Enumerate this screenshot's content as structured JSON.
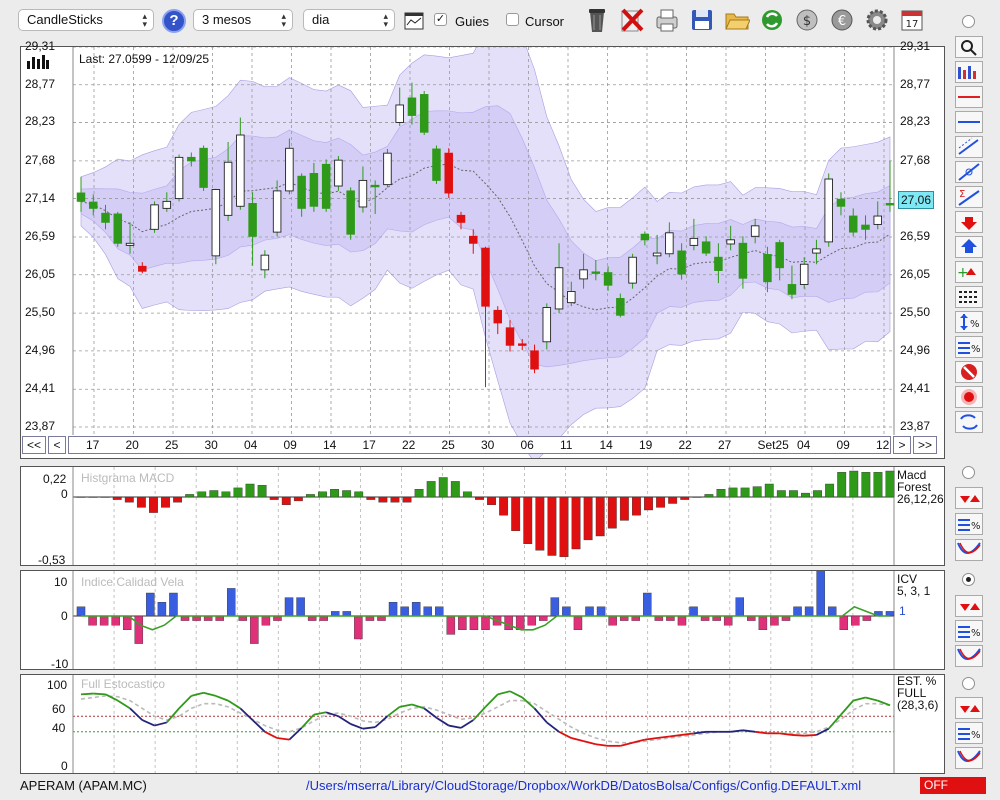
{
  "toolbar": {
    "chart_type": "CandleSticks",
    "period": "3 mesos",
    "interval": "dia",
    "guides_label": "Guies",
    "guides_checked": true,
    "cursor_label": "Cursor",
    "cursor_checked": false,
    "calendar_day": "17",
    "help_label": "?"
  },
  "main_chart": {
    "last_label": "Last: 27.0599 - 12/09/25",
    "current_price": "27,06",
    "y_labels": [
      "23,87",
      "24,41",
      "24,96",
      "25,50",
      "26,05",
      "26,59",
      "27,14",
      "27,68",
      "28,23",
      "28,77",
      "29,31"
    ],
    "date_labels": [
      "17",
      "20",
      "25",
      "30",
      "04",
      "09",
      "14",
      "17",
      "22",
      "25",
      "30",
      "06",
      "11",
      "14",
      "19",
      "22",
      "27",
      "Set25",
      "04",
      "09",
      "12"
    ],
    "nav": {
      "first": "<<",
      "prev": "<",
      "next": ">",
      "last": ">>"
    }
  },
  "macd_panel": {
    "title": "Histgrama MACD",
    "y_labels": [
      "0,22",
      "0",
      "-0,53"
    ],
    "right_lines": [
      "Macd",
      "Forest",
      "26,12,26"
    ]
  },
  "icv_panel": {
    "title": "Indice Calidad Vela",
    "y_labels": [
      "10",
      "0",
      "-10"
    ],
    "right_lines": [
      "ICV",
      "5, 3, 1"
    ],
    "value": "1"
  },
  "stoch_panel": {
    "title": "Full Estocastico",
    "y_labels": [
      "100",
      "60",
      "40",
      "0"
    ],
    "right_lines": [
      "EST. %",
      "FULL",
      "(28,3,6)"
    ]
  },
  "status": {
    "ticker": "APERAM (APAM.MC)",
    "config_path": "/Users/mserra/Library/CloudStorage/Dropbox/WorkDB/DatosBolsa/Configs/Config.DEFAULT.xml",
    "mode": "OFF"
  },
  "colors": {
    "up": "#2f9a1a",
    "down": "#e01010",
    "band": "#e4e0fa",
    "macd_pos": "#2f9a1a",
    "macd_neg": "#e01010",
    "icv_pos": "#3a5ee0",
    "icv_neg": "#e0307a",
    "accent": "#2b5fd9"
  },
  "chart_data": [
    {
      "type": "candlestick",
      "title": "",
      "ylim": [
        23.87,
        29.31
      ],
      "series": [
        {
          "name": "APAM.MC",
          "ohlc": [
            [
              27.22,
              27.1,
              27.45,
              26.95
            ],
            [
              27.09,
              27.0,
              27.2,
              26.9
            ],
            [
              26.93,
              26.8,
              27.05,
              26.7
            ],
            [
              26.92,
              26.5,
              26.95,
              26.45
            ],
            [
              26.47,
              26.5,
              26.8,
              26.35
            ],
            [
              26.17,
              26.1,
              26.23,
              26.07
            ],
            [
              26.7,
              27.05,
              27.1,
              26.65
            ],
            [
              27.0,
              27.1,
              27.23,
              26.95
            ],
            [
              27.14,
              27.73,
              27.77,
              27.1
            ],
            [
              27.73,
              27.68,
              27.8,
              27.6
            ],
            [
              27.86,
              27.3,
              27.9,
              27.25
            ],
            [
              26.32,
              27.27,
              27.28,
              26.2
            ],
            [
              26.9,
              27.66,
              27.95,
              26.82
            ],
            [
              27.03,
              28.05,
              28.3,
              26.98
            ],
            [
              27.07,
              26.6,
              27.23,
              26.18
            ],
            [
              26.12,
              26.33,
              26.4,
              26.0
            ],
            [
              26.66,
              27.25,
              27.4,
              26.6
            ],
            [
              27.25,
              27.86,
              28.0,
              27.2
            ],
            [
              27.46,
              27.0,
              27.5,
              26.88
            ],
            [
              27.5,
              27.03,
              27.65,
              26.95
            ],
            [
              27.63,
              27.0,
              27.7,
              26.95
            ],
            [
              27.32,
              27.69,
              27.75,
              27.25
            ],
            [
              27.25,
              26.63,
              27.3,
              26.55
            ],
            [
              27.02,
              27.4,
              27.6,
              26.94
            ],
            [
              27.33,
              27.32,
              27.4,
              26.92
            ],
            [
              27.34,
              27.79,
              27.85,
              27.3
            ],
            [
              28.23,
              28.48,
              28.73,
              28.18
            ],
            [
              28.58,
              28.33,
              28.8,
              28.2
            ],
            [
              28.63,
              28.09,
              28.68,
              28.05
            ],
            [
              27.85,
              27.4,
              27.9,
              27.35
            ],
            [
              27.79,
              27.22,
              27.86,
              27.15
            ],
            [
              26.9,
              26.8,
              26.95,
              26.7
            ],
            [
              26.6,
              26.5,
              26.7,
              26.35
            ],
            [
              26.43,
              25.6,
              26.45,
              24.44
            ],
            [
              25.54,
              25.36,
              25.6,
              25.2
            ],
            [
              25.29,
              25.04,
              25.4,
              24.95
            ],
            [
              25.06,
              25.04,
              25.13,
              24.97
            ],
            [
              24.96,
              24.7,
              25.05,
              24.64
            ],
            [
              25.09,
              25.58,
              25.64,
              24.98
            ],
            [
              25.56,
              26.15,
              26.5,
              25.5
            ],
            [
              25.65,
              25.81,
              25.95,
              25.6
            ],
            [
              25.99,
              26.12,
              26.35,
              25.85
            ],
            [
              26.09,
              26.07,
              26.26,
              25.97
            ],
            [
              26.08,
              25.9,
              26.17,
              25.82
            ],
            [
              25.71,
              25.47,
              25.78,
              25.44
            ],
            [
              25.93,
              26.3,
              26.35,
              25.85
            ],
            [
              26.63,
              26.55,
              26.67,
              26.47
            ],
            [
              26.32,
              26.36,
              26.62,
              26.2
            ],
            [
              26.35,
              26.65,
              26.8,
              26.3
            ],
            [
              26.39,
              26.06,
              26.5,
              25.98
            ],
            [
              26.47,
              26.57,
              26.85,
              26.4
            ],
            [
              26.52,
              26.36,
              26.6,
              26.32
            ],
            [
              26.3,
              26.11,
              26.5,
              25.93
            ],
            [
              26.49,
              26.55,
              26.75,
              26.4
            ],
            [
              26.5,
              26.0,
              26.6,
              25.85
            ],
            [
              26.6,
              26.75,
              26.85,
              26.5
            ],
            [
              26.34,
              25.95,
              26.45,
              25.8
            ],
            [
              26.51,
              26.15,
              26.55,
              25.97
            ],
            [
              25.91,
              25.77,
              26.18,
              25.7
            ],
            [
              25.91,
              26.2,
              26.3,
              25.85
            ],
            [
              26.36,
              26.42,
              26.55,
              26.2
            ],
            [
              26.52,
              27.42,
              27.5,
              26.45
            ],
            [
              27.13,
              27.03,
              27.23,
              26.9
            ],
            [
              26.89,
              26.66,
              27.0,
              26.6
            ],
            [
              26.76,
              26.7,
              26.9,
              26.55
            ],
            [
              26.77,
              26.89,
              27.1,
              26.7
            ],
            [
              27.07,
              27.06,
              27.68,
              26.95
            ]
          ]
        }
      ],
      "date_labels": [
        "17",
        "20",
        "25",
        "30",
        "04",
        "09",
        "14",
        "17",
        "22",
        "25",
        "30",
        "06",
        "11",
        "14",
        "19",
        "22",
        "27",
        "Set25",
        "04",
        "09",
        "12"
      ]
    },
    {
      "type": "bar",
      "title": "Histgrama MACD",
      "ylim": [
        -0.53,
        0.22
      ],
      "values": [
        0,
        0,
        0,
        -0.02,
        -0.04,
        -0.08,
        -0.12,
        -0.08,
        -0.04,
        0.02,
        0.04,
        0.05,
        0.04,
        0.07,
        0.1,
        0.09,
        -0.02,
        -0.06,
        -0.03,
        0.02,
        0.04,
        0.06,
        0.05,
        0.04,
        -0.02,
        -0.04,
        -0.04,
        -0.04,
        0.06,
        0.12,
        0.15,
        0.12,
        0.04,
        -0.02,
        -0.06,
        -0.14,
        -0.26,
        -0.36,
        -0.41,
        -0.45,
        -0.46,
        -0.4,
        -0.33,
        -0.3,
        -0.24,
        -0.18,
        -0.14,
        -0.1,
        -0.08,
        -0.05,
        -0.02,
        0,
        0.02,
        0.06,
        0.07,
        0.07,
        0.08,
        0.1,
        0.05,
        0.05,
        0.03,
        0.05,
        0.1,
        0.19,
        0.2,
        0.19,
        0.19,
        0.2
      ]
    },
    {
      "type": "bar",
      "title": "Indice Calidad Vela",
      "ylim": [
        -10,
        10
      ],
      "values": [
        2,
        -2,
        -2,
        -2,
        -3,
        -6,
        5,
        3,
        5,
        -1,
        -1,
        -1,
        -1,
        6,
        -1,
        -6,
        -2,
        -1,
        4,
        4,
        -1,
        -1,
        1,
        1,
        -5,
        -1,
        -1,
        3,
        2,
        3,
        2,
        2,
        -4,
        -3,
        -3,
        -3,
        -2,
        -3,
        -3,
        -2,
        -1,
        4,
        2,
        -3,
        2,
        2,
        -2,
        -1,
        -1,
        5,
        -1,
        -1,
        -2,
        2,
        -1,
        -1,
        -2,
        4,
        -1,
        -3,
        -2,
        -1,
        2,
        2,
        10,
        2,
        -3,
        -2,
        -1,
        1,
        1
      ],
      "series": [
        {
          "name": "1",
          "values": [
            0,
            0,
            0,
            0,
            0,
            -2,
            -3,
            -2,
            0,
            0,
            0,
            0,
            0,
            0,
            0,
            0,
            0,
            0,
            0,
            0,
            0,
            0,
            0,
            0,
            0,
            0,
            0,
            0,
            0,
            0,
            0,
            0,
            0,
            0,
            0,
            -1,
            -2,
            -3,
            -3,
            -2,
            0,
            0,
            0,
            0,
            0,
            0,
            0,
            0,
            0,
            0,
            0,
            0,
            0,
            0,
            0,
            0,
            0,
            0,
            0,
            0,
            0,
            0,
            0,
            0,
            0,
            2,
            1,
            0,
            0
          ]
        }
      ]
    },
    {
      "type": "line",
      "title": "Full Estocastico",
      "ylim": [
        0,
        100
      ],
      "series": [
        {
          "name": "%K",
          "values": [
            88,
            89,
            88,
            80,
            70,
            55,
            48,
            52,
            70,
            86,
            90,
            86,
            80,
            70,
            55,
            40,
            32,
            30,
            45,
            62,
            65,
            60,
            50,
            44,
            46,
            60,
            72,
            75,
            70,
            58,
            48,
            45,
            55,
            72,
            88,
            92,
            84,
            70,
            52,
            40,
            32,
            28,
            24,
            22,
            22,
            26,
            30,
            32,
            34,
            36,
            38,
            40,
            40,
            40,
            42,
            40,
            38,
            38,
            36,
            35,
            36,
            44,
            62,
            80,
            84,
            80,
            74
          ]
        },
        {
          "name": "%D",
          "values": [
            82,
            84,
            86,
            85,
            80,
            70,
            60,
            55,
            60,
            70,
            76,
            76,
            72,
            64,
            56,
            48,
            42,
            40,
            45,
            54,
            62,
            64,
            60,
            54,
            52,
            56,
            64,
            70,
            72,
            68,
            62,
            56,
            58,
            64,
            72,
            80,
            80,
            76,
            66,
            56,
            46,
            38,
            32,
            28,
            26,
            26,
            28,
            30,
            32,
            34,
            36,
            38,
            40,
            40,
            41,
            40,
            39,
            38,
            38,
            38,
            40,
            46,
            56,
            68,
            76,
            76,
            74
          ]
        }
      ]
    }
  ]
}
